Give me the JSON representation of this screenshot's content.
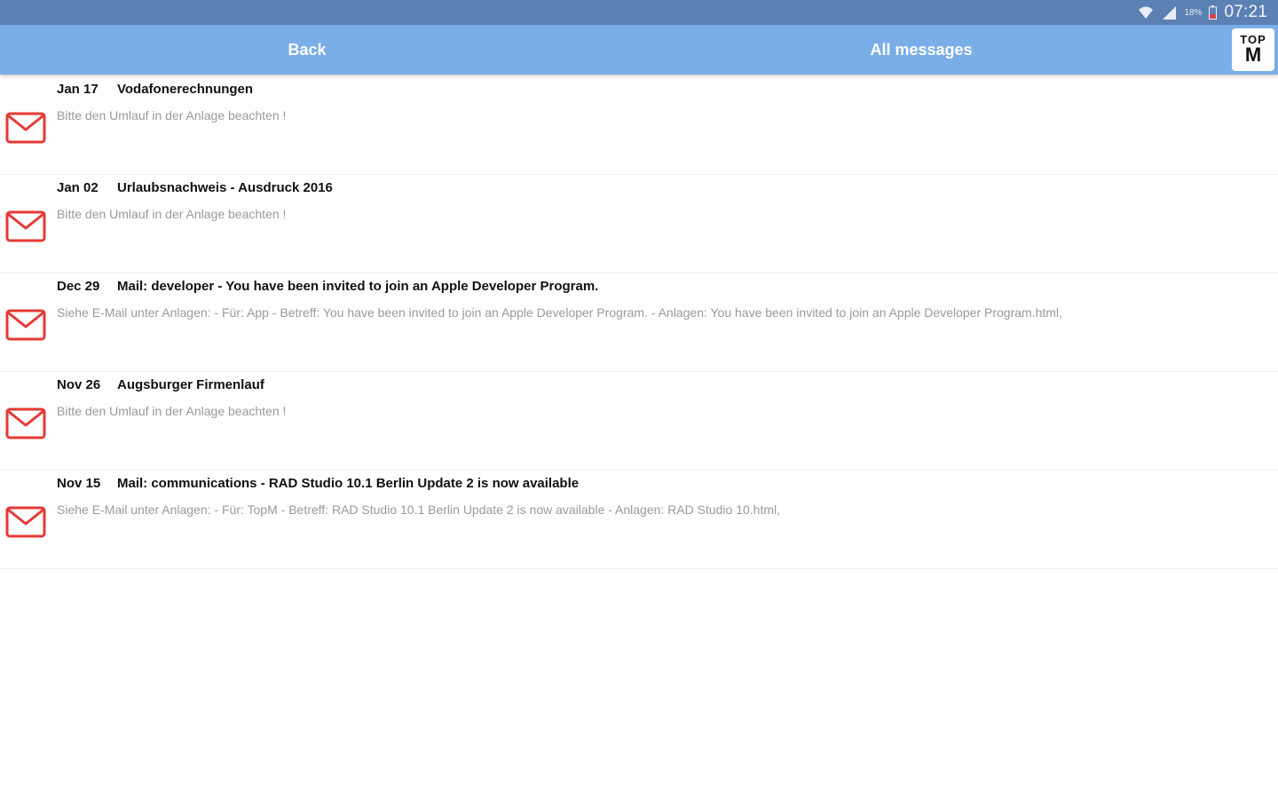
{
  "status_bar": {
    "icons": [
      "wifi-icon",
      "signal-icon",
      "battery-icon"
    ],
    "battery_percent": "18%",
    "time": "07:21"
  },
  "header": {
    "back_label": "Back",
    "title": "All messages",
    "logo_top": "TOP",
    "logo_bottom": "M"
  },
  "colors": {
    "status_bar": "#5b80b4",
    "app_bar": "#79aee8",
    "mail_icon": "#e53935",
    "preview_text": "#9a9a9a"
  },
  "messages": [
    {
      "date": "Jan 17",
      "subject": "Vodafonerechnungen",
      "preview": "Bitte den Umlauf in der Anlage beachten !"
    },
    {
      "date": "Jan 02",
      "subject": "Urlaubsnachweis - Ausdruck 2016",
      "preview": "Bitte den Umlauf in der Anlage beachten !"
    },
    {
      "date": "Dec 29",
      "subject": "Mail: developer - You have been invited to join an Apple Developer Program.",
      "preview": "Siehe E-Mail unter Anlagen: - Für: App - Betreff: You have been invited to join an Apple Developer Program. - Anlagen: You have been invited to join an Apple Developer Program.html,"
    },
    {
      "date": "Nov 26",
      "subject": "Augsburger Firmenlauf",
      "preview": "Bitte den Umlauf in der Anlage beachten !"
    },
    {
      "date": "Nov 15",
      "subject": "Mail: communications - RAD Studio 10.1 Berlin Update 2 is now available",
      "preview": "Siehe E-Mail unter Anlagen: - Für: TopM - Betreff: RAD Studio 10.1 Berlin Update 2 is now available - Anlagen: RAD Studio 10.html,"
    }
  ]
}
